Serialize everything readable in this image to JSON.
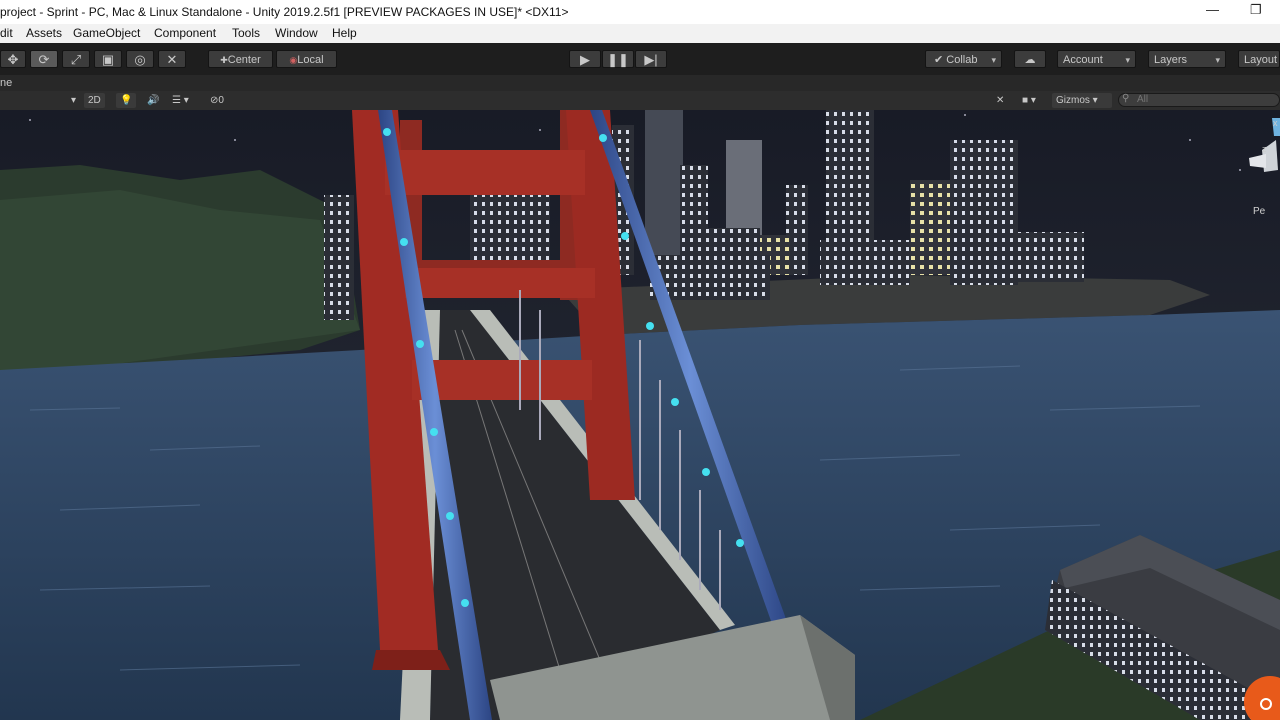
{
  "window": {
    "title": "project - Sprint - PC, Mac & Linux Standalone - Unity 2019.2.5f1 [PREVIEW PACKAGES IN USE]* <DX11>",
    "minimize_glyph": "—",
    "maximize_glyph": "❐"
  },
  "menu": [
    "dit",
    "Assets",
    "GameObject",
    "Component",
    "Tools",
    "Window",
    "Help"
  ],
  "toolbar": {
    "pivot_label": "Center",
    "rotation_label": "Local",
    "collab_label": "Collab",
    "account_label": "Account",
    "layers_label": "Layers",
    "layout_label": "Layout",
    "play_icon": "play-icon",
    "pause_icon": "pause-icon",
    "step_icon": "step-icon"
  },
  "scene_tab": {
    "tab_label": "ne"
  },
  "scene_toolbar": {
    "mode_2d": "2D",
    "hidden_count": "0",
    "gizmos_label": "Gizmos",
    "search_placeholder": "All",
    "gizmo_label": "Pe"
  },
  "colors": {
    "toolbar_bg": "#1e1e1e",
    "button_bg": "#3c3c3c",
    "night_sky": "#1b1f28",
    "water": "#2f4a6c",
    "bridge_red": "#9b2a22",
    "cable_blue": "#4a6fb3",
    "light_cyan": "#45e0f0"
  }
}
